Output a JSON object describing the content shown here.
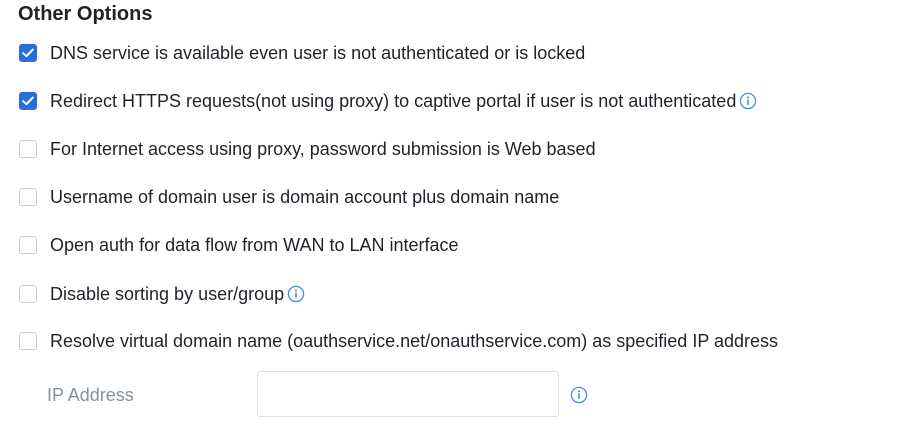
{
  "section": {
    "title": "Other Options"
  },
  "options": [
    {
      "label": "DNS service is available even user is not authenticated or is locked",
      "checked": true,
      "info": false
    },
    {
      "label": "Redirect HTTPS requests(not using proxy) to captive portal if user is not authenticated",
      "checked": true,
      "info": true
    },
    {
      "label": "For Internet access using proxy, password submission is Web based",
      "checked": false,
      "info": false
    },
    {
      "label": "Username of domain user is domain account plus domain name",
      "checked": false,
      "info": false
    },
    {
      "label": "Open auth for data flow from WAN to LAN interface",
      "checked": false,
      "info": false
    },
    {
      "label": "Disable sorting by user/group",
      "checked": false,
      "info": true
    },
    {
      "label": "Resolve virtual domain name (oauthservice.net/onauthservice.com) as specified IP address",
      "checked": false,
      "info": false
    }
  ],
  "ip_address": {
    "label": "IP Address",
    "value": "",
    "placeholder": "",
    "info_icon": "info-icon"
  },
  "colors": {
    "accent": "#2b6fd6",
    "checkbox_border": "#c9cdd4",
    "muted_text": "#86909c",
    "info_icon": "#4a8de9"
  }
}
